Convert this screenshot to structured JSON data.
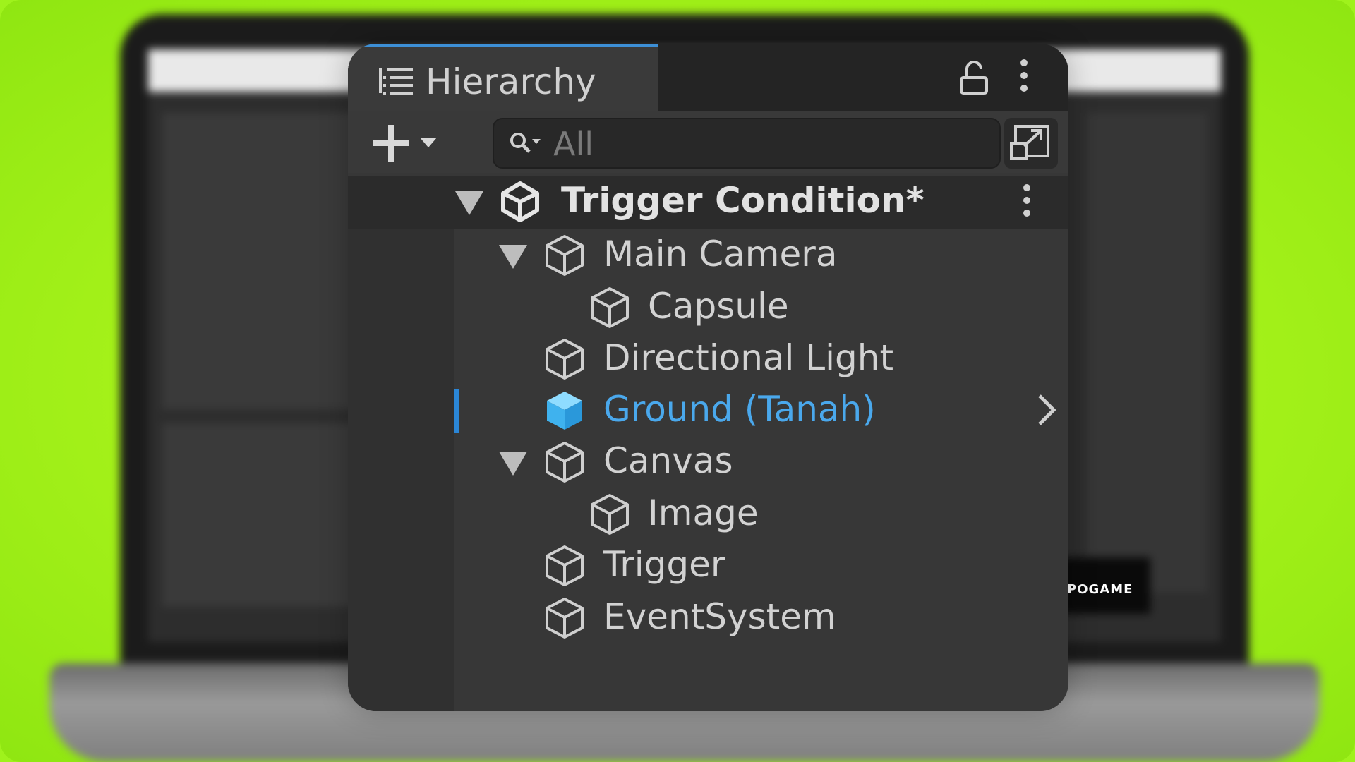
{
  "panel": {
    "tab_title": "Hierarchy",
    "icons": {
      "tab": "list-icon",
      "lock": "lock-icon",
      "menu": "kebab-menu-icon",
      "add": "plus-icon",
      "search": "search-icon",
      "scene_view": "open-scene-icon"
    }
  },
  "search": {
    "placeholder": "All"
  },
  "scene": {
    "name": "Trigger Condition*",
    "icon": "unity-logo-icon"
  },
  "tree": [
    {
      "label": "Main Camera",
      "depth": 0,
      "expanded": true,
      "icon": "gameobject-cube-icon"
    },
    {
      "label": "Capsule",
      "depth": 1,
      "icon": "gameobject-cube-icon"
    },
    {
      "label": "Directional Light",
      "depth": 0,
      "icon": "gameobject-cube-icon"
    },
    {
      "label": "Ground (Tanah)",
      "depth": 0,
      "selected": true,
      "icon": "gameobject-cube-icon"
    },
    {
      "label": "Canvas",
      "depth": 0,
      "expanded": true,
      "icon": "gameobject-cube-icon"
    },
    {
      "label": "Image",
      "depth": 1,
      "icon": "gameobject-cube-icon"
    },
    {
      "label": "Trigger",
      "depth": 0,
      "icon": "gameobject-cube-icon"
    },
    {
      "label": "EventSystem",
      "depth": 0,
      "icon": "gameobject-cube-icon"
    }
  ],
  "background": {
    "watermark": "POGAME"
  },
  "colors": {
    "accent": "#3d8fd6",
    "selected_text": "#4aa8ec",
    "frame": "#9ff21c",
    "panel_bg": "#373737"
  }
}
